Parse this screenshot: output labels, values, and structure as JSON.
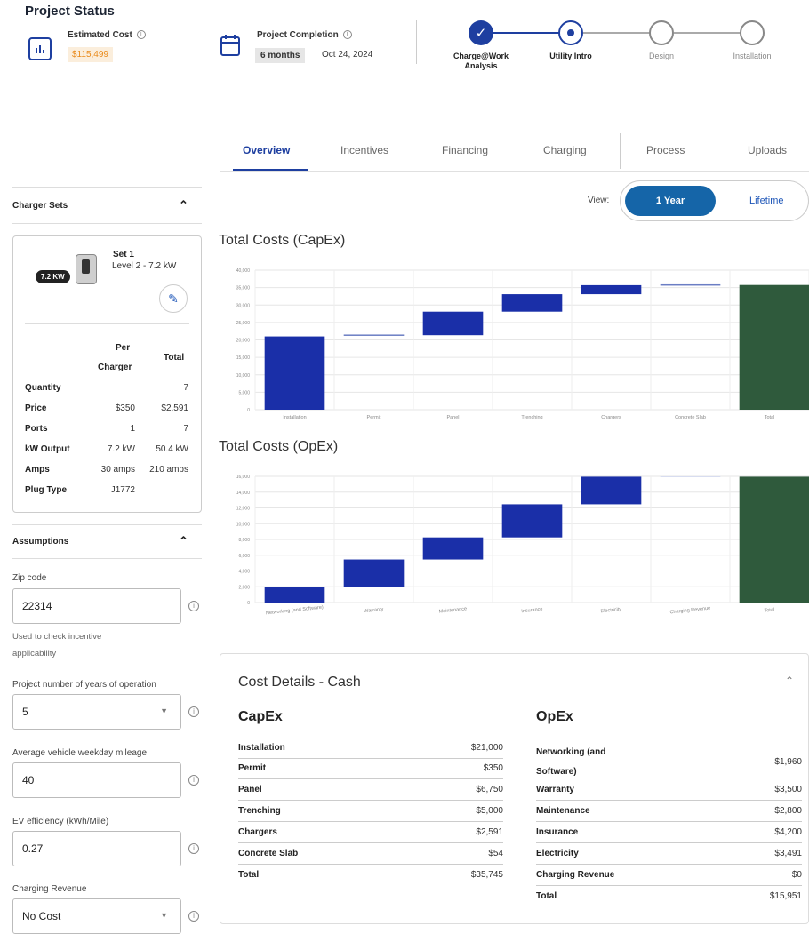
{
  "header": {
    "title": "Project Status",
    "estimated_cost_label": "Estimated Cost",
    "estimated_cost_value": "$115,499",
    "completion_label": "Project Completion",
    "completion_duration": "6 months",
    "completion_date": "Oct 24, 2024"
  },
  "steps": [
    {
      "label": "Charge@Work Analysis",
      "state": "done"
    },
    {
      "label": "Utility Intro",
      "state": "active"
    },
    {
      "label": "Design",
      "state": "todo"
    },
    {
      "label": "Installation",
      "state": "todo"
    }
  ],
  "tabs": [
    "Overview",
    "Incentives",
    "Financing",
    "Charging",
    "Process",
    "Uploads"
  ],
  "view": {
    "label": "View:",
    "selected": "1 Year",
    "other": "Lifetime"
  },
  "charger_sets": {
    "title": "Charger Sets",
    "badge": "7.2 KW",
    "set_name": "Set 1",
    "set_desc": "Level 2 - 7.2 kW",
    "col_per": "Per",
    "col_charger": "Charger",
    "col_total": "Total",
    "rows": [
      {
        "label": "Quantity",
        "per": "",
        "total": "7"
      },
      {
        "label": "Price",
        "per": "$350",
        "total": "$2,591"
      },
      {
        "label": "Ports",
        "per": "1",
        "total": "7"
      },
      {
        "label": "kW Output",
        "per": "7.2 kW",
        "total": "50.4 kW"
      },
      {
        "label": "Amps",
        "per": "30 amps",
        "total": "210 amps"
      },
      {
        "label": "Plug Type",
        "per": "J1772",
        "total": ""
      }
    ]
  },
  "assumptions": {
    "title": "Assumptions",
    "zip_label": "Zip code",
    "zip_value": "22314",
    "zip_hint": "Used to check incentive applicability",
    "years_label": "Project number of years of operation",
    "years_value": "5",
    "mileage_label": "Average vehicle weekday mileage",
    "mileage_value": "40",
    "efficiency_label": "EV efficiency (kWh/Mile)",
    "efficiency_value": "0.27",
    "revenue_label": "Charging Revenue",
    "revenue_value": "No Cost"
  },
  "colors": {
    "accent": "#1e3fa0",
    "bar": "#1a2fa8",
    "total_bar": "#2f5a3c",
    "cost_text": "#e98a1a"
  },
  "chart_data": [
    {
      "type": "bar",
      "title": "Total Costs (CapEx)",
      "categories": [
        "Installation",
        "Permit",
        "Panel",
        "Trenching",
        "Chargers",
        "Concrete Slab",
        "Total"
      ],
      "values": [
        21000,
        350,
        6750,
        5000,
        2591,
        54,
        35745
      ],
      "ylim": [
        0,
        40000
      ],
      "yticks": [
        "0",
        "5,000",
        "10,000",
        "15,000",
        "20,000",
        "25,000",
        "30,000",
        "35,000",
        "40,000"
      ]
    },
    {
      "type": "bar",
      "title": "Total Costs (OpEx)",
      "categories": [
        "Networking (and Software)",
        "Warranty",
        "Maintenance",
        "Insurance",
        "Electricity",
        "Charging Revenue",
        "Total"
      ],
      "values": [
        1960,
        3500,
        2800,
        4200,
        3491,
        0,
        15951
      ],
      "ylim": [
        0,
        16000
      ],
      "yticks": [
        "0",
        "2,000",
        "4,000",
        "6,000",
        "8,000",
        "10,000",
        "12,000",
        "14,000",
        "16,000"
      ]
    }
  ],
  "cost_details": {
    "title": "Cost Details - Cash",
    "capex_title": "CapEx",
    "opex_title": "OpEx",
    "capex_rows": [
      {
        "label": "Installation",
        "value": "$21,000"
      },
      {
        "label": "Permit",
        "value": "$350"
      },
      {
        "label": "Panel",
        "value": "$6,750"
      },
      {
        "label": "Trenching",
        "value": "$5,000"
      },
      {
        "label": "Chargers",
        "value": "$2,591"
      },
      {
        "label": "Concrete Slab",
        "value": "$54"
      },
      {
        "label": "Total",
        "value": "$35,745"
      }
    ],
    "opex_rows": [
      {
        "label": "Networking (and Software)",
        "value": "$1,960"
      },
      {
        "label": "Warranty",
        "value": "$3,500"
      },
      {
        "label": "Maintenance",
        "value": "$2,800"
      },
      {
        "label": "Insurance",
        "value": "$4,200"
      },
      {
        "label": "Electricity",
        "value": "$3,491"
      },
      {
        "label": "Charging Revenue",
        "value": "$0"
      },
      {
        "label": "Total",
        "value": "$15,951"
      }
    ]
  }
}
